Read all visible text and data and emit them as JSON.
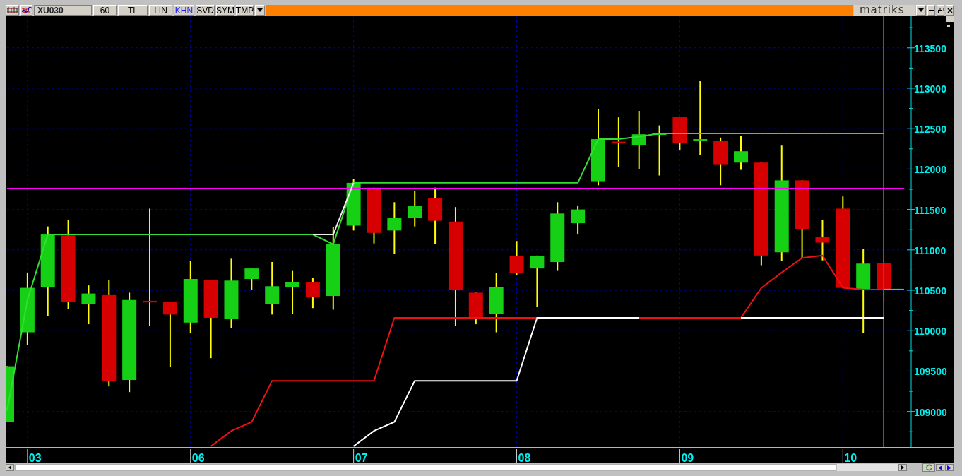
{
  "toolbar": {
    "symbol": "XU030",
    "buttons": [
      {
        "label": "60",
        "selected": false
      },
      {
        "label": "TL",
        "selected": false
      },
      {
        "label": "LIN",
        "selected": false
      },
      {
        "label": "KHN",
        "selected": true
      },
      {
        "label": "SVD",
        "selected": false
      },
      {
        "label": "SYM",
        "selected": false
      },
      {
        "label": "TMP",
        "selected": false
      }
    ],
    "logo": "matriks"
  },
  "chart": {
    "chart_data": {
      "type": "line",
      "ylim": [
        108560,
        113900
      ],
      "grid": true,
      "categories": [
        null,
        "03",
        null,
        null,
        null,
        null,
        null,
        null,
        null,
        "06",
        null,
        null,
        null,
        null,
        null,
        null,
        null,
        "07",
        null,
        null,
        null,
        null,
        null,
        null,
        null,
        "08",
        null,
        null,
        null,
        null,
        null,
        null,
        null,
        "09",
        null,
        null,
        null,
        null,
        null,
        null,
        null,
        "10",
        null,
        null,
        null
      ],
      "yticks": [
        {
          "value": 109000,
          "label": "109000"
        },
        {
          "value": 109500,
          "label": "109500"
        },
        {
          "value": 110000,
          "label": "110000"
        },
        {
          "value": 110500,
          "label": "110500"
        },
        {
          "value": 111000,
          "label": "111000"
        },
        {
          "value": 111500,
          "label": "111500"
        },
        {
          "value": 112000,
          "label": "112000"
        },
        {
          "value": 112500,
          "label": "112500"
        },
        {
          "value": 113000,
          "label": "113000"
        },
        {
          "value": 113500,
          "label": "113500"
        }
      ],
      "series": [
        {
          "color": "#ff00ff",
          "values": [
            111760,
            111760,
            111760,
            111760,
            111760,
            111760,
            111760,
            111760,
            111760,
            111760,
            111760,
            111760,
            111760,
            111760,
            111760,
            111760,
            111760,
            111760,
            111760,
            111760,
            111760,
            111760,
            111760,
            111760,
            111760,
            111760,
            111760,
            111760,
            111760,
            111760,
            111760,
            111760,
            111760,
            111760,
            111760,
            111760,
            111760,
            111760,
            111760,
            111760,
            111760,
            111760,
            111760,
            111760,
            111760
          ]
        },
        {
          "color": "#33dd33",
          "values": [
            109010,
            110380,
            111190,
            111190,
            111190,
            111190,
            111190,
            111190,
            111190,
            111190,
            111190,
            111190,
            111190,
            111190,
            111190,
            111190,
            111070,
            111830,
            111830,
            111830,
            111830,
            111830,
            111830,
            111830,
            111830,
            111830,
            111830,
            111830,
            111830,
            112370,
            112370,
            112400,
            112440,
            112440,
            112440,
            112440,
            112440,
            112440,
            112440,
            112440,
            112440,
            112440,
            112440,
            112440,
            null
          ]
        },
        {
          "color": "#2ee62e",
          "values": [
            null,
            null,
            null,
            null,
            null,
            null,
            null,
            null,
            null,
            null,
            null,
            null,
            null,
            null,
            null,
            null,
            null,
            null,
            null,
            null,
            null,
            null,
            null,
            null,
            null,
            null,
            null,
            null,
            null,
            null,
            null,
            null,
            null,
            null,
            null,
            null,
            null,
            null,
            null,
            null,
            null,
            null,
            null,
            110510,
            110510
          ]
        },
        {
          "color": "#f0f0f0",
          "values": [
            null,
            null,
            null,
            null,
            null,
            null,
            null,
            null,
            null,
            null,
            null,
            null,
            null,
            null,
            null,
            111190,
            111190,
            111830,
            null,
            null,
            null,
            null,
            null,
            null,
            null,
            null,
            null,
            null,
            null,
            null,
            null,
            null,
            null,
            null,
            null,
            null,
            null,
            null,
            null,
            null,
            null,
            null,
            null,
            null,
            null
          ]
        },
        {
          "color": "#ee1111",
          "values": [
            null,
            null,
            null,
            null,
            null,
            null,
            null,
            null,
            null,
            null,
            108570,
            108760,
            108870,
            109380,
            109380,
            109380,
            109380,
            109380,
            109380,
            110160,
            110160,
            110160,
            110160,
            110160,
            110160,
            110160,
            110160,
            null,
            null,
            null,
            null,
            110160,
            110160,
            110160,
            110160,
            110160,
            110160,
            110530,
            110720,
            110900,
            110930,
            110530,
            110510,
            110510,
            null
          ]
        },
        {
          "color": "#ffffff",
          "values": [
            null,
            null,
            null,
            null,
            null,
            null,
            null,
            null,
            null,
            null,
            null,
            null,
            null,
            null,
            null,
            null,
            null,
            108570,
            108760,
            108870,
            109380,
            109380,
            109380,
            109380,
            109380,
            109380,
            110160,
            110160,
            110160,
            110160,
            110160,
            110160,
            null,
            null,
            null,
            null,
            110160,
            110160,
            110160,
            110160,
            110160,
            110160,
            110160,
            110160,
            null
          ]
        }
      ]
    }
  }
}
